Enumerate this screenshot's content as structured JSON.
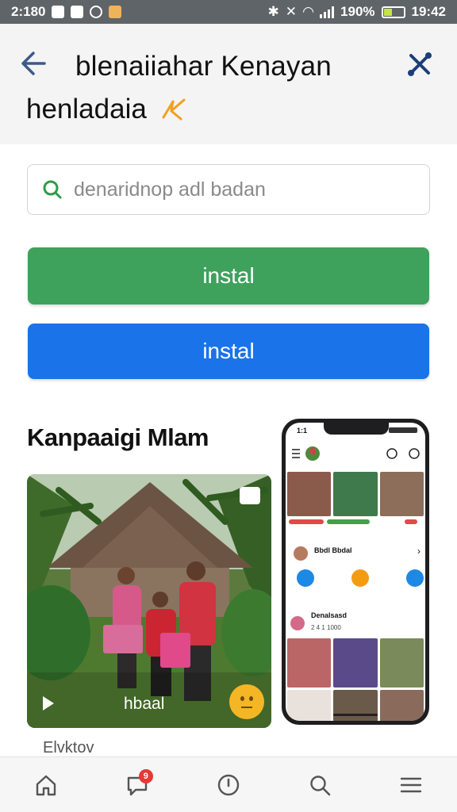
{
  "status_bar": {
    "time_left": "2:180",
    "battery": "190%",
    "clock": "19:42"
  },
  "header": {
    "title_line1": "blenaiiahar Kenayan",
    "title_line2": "henladaia"
  },
  "search": {
    "placeholder": "denaridnop adl badan"
  },
  "buttons": {
    "install_green": "instal",
    "install_blue": "instal"
  },
  "section": {
    "title": "Kanpaaigi Mlam"
  },
  "photo_card": {
    "caption": "hbaal",
    "below_text": "Elvktov"
  },
  "phone_mockup": {
    "status_time": "1:1",
    "row1_text": "Bbdl Bbdal",
    "row2_title": "Denalsasd",
    "row2_sub": "2 4 1 1000"
  },
  "bottom_nav": {
    "items": [
      "home-icon",
      "messages-icon",
      "clock-icon",
      "search-icon",
      "menu-icon"
    ],
    "badge": "9"
  },
  "colors": {
    "green": "#3ea25c",
    "blue": "#1a73e8",
    "accent_orange": "#f0a020"
  }
}
